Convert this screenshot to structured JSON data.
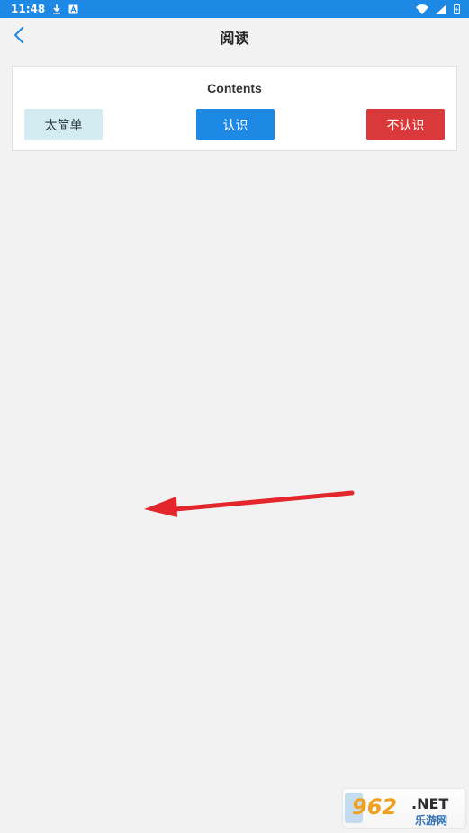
{
  "status_bar": {
    "time": "11:48",
    "left_icons": [
      "download-icon",
      "a-notification-icon"
    ],
    "right_icons": [
      "wifi-icon",
      "signal-icon",
      "battery-icon"
    ],
    "background": "#1e88e5"
  },
  "header": {
    "title": "阅读",
    "back_icon": "chevron-left-icon",
    "accent": "#1e88e5"
  },
  "card": {
    "title": "Contents",
    "buttons": {
      "easy": "太简单",
      "know": "认识",
      "unknown": "不认识"
    },
    "colors": {
      "easy": "#d3ecf1",
      "know": "#1e88e5",
      "unknown": "#d9393b"
    }
  },
  "overlay": {
    "swipe_arrow_icon": "arrow-left-icon",
    "arrow_color": "#e3262c"
  },
  "watermark": {
    "logo_text": "962.NET",
    "sub_text": "乐游网"
  }
}
